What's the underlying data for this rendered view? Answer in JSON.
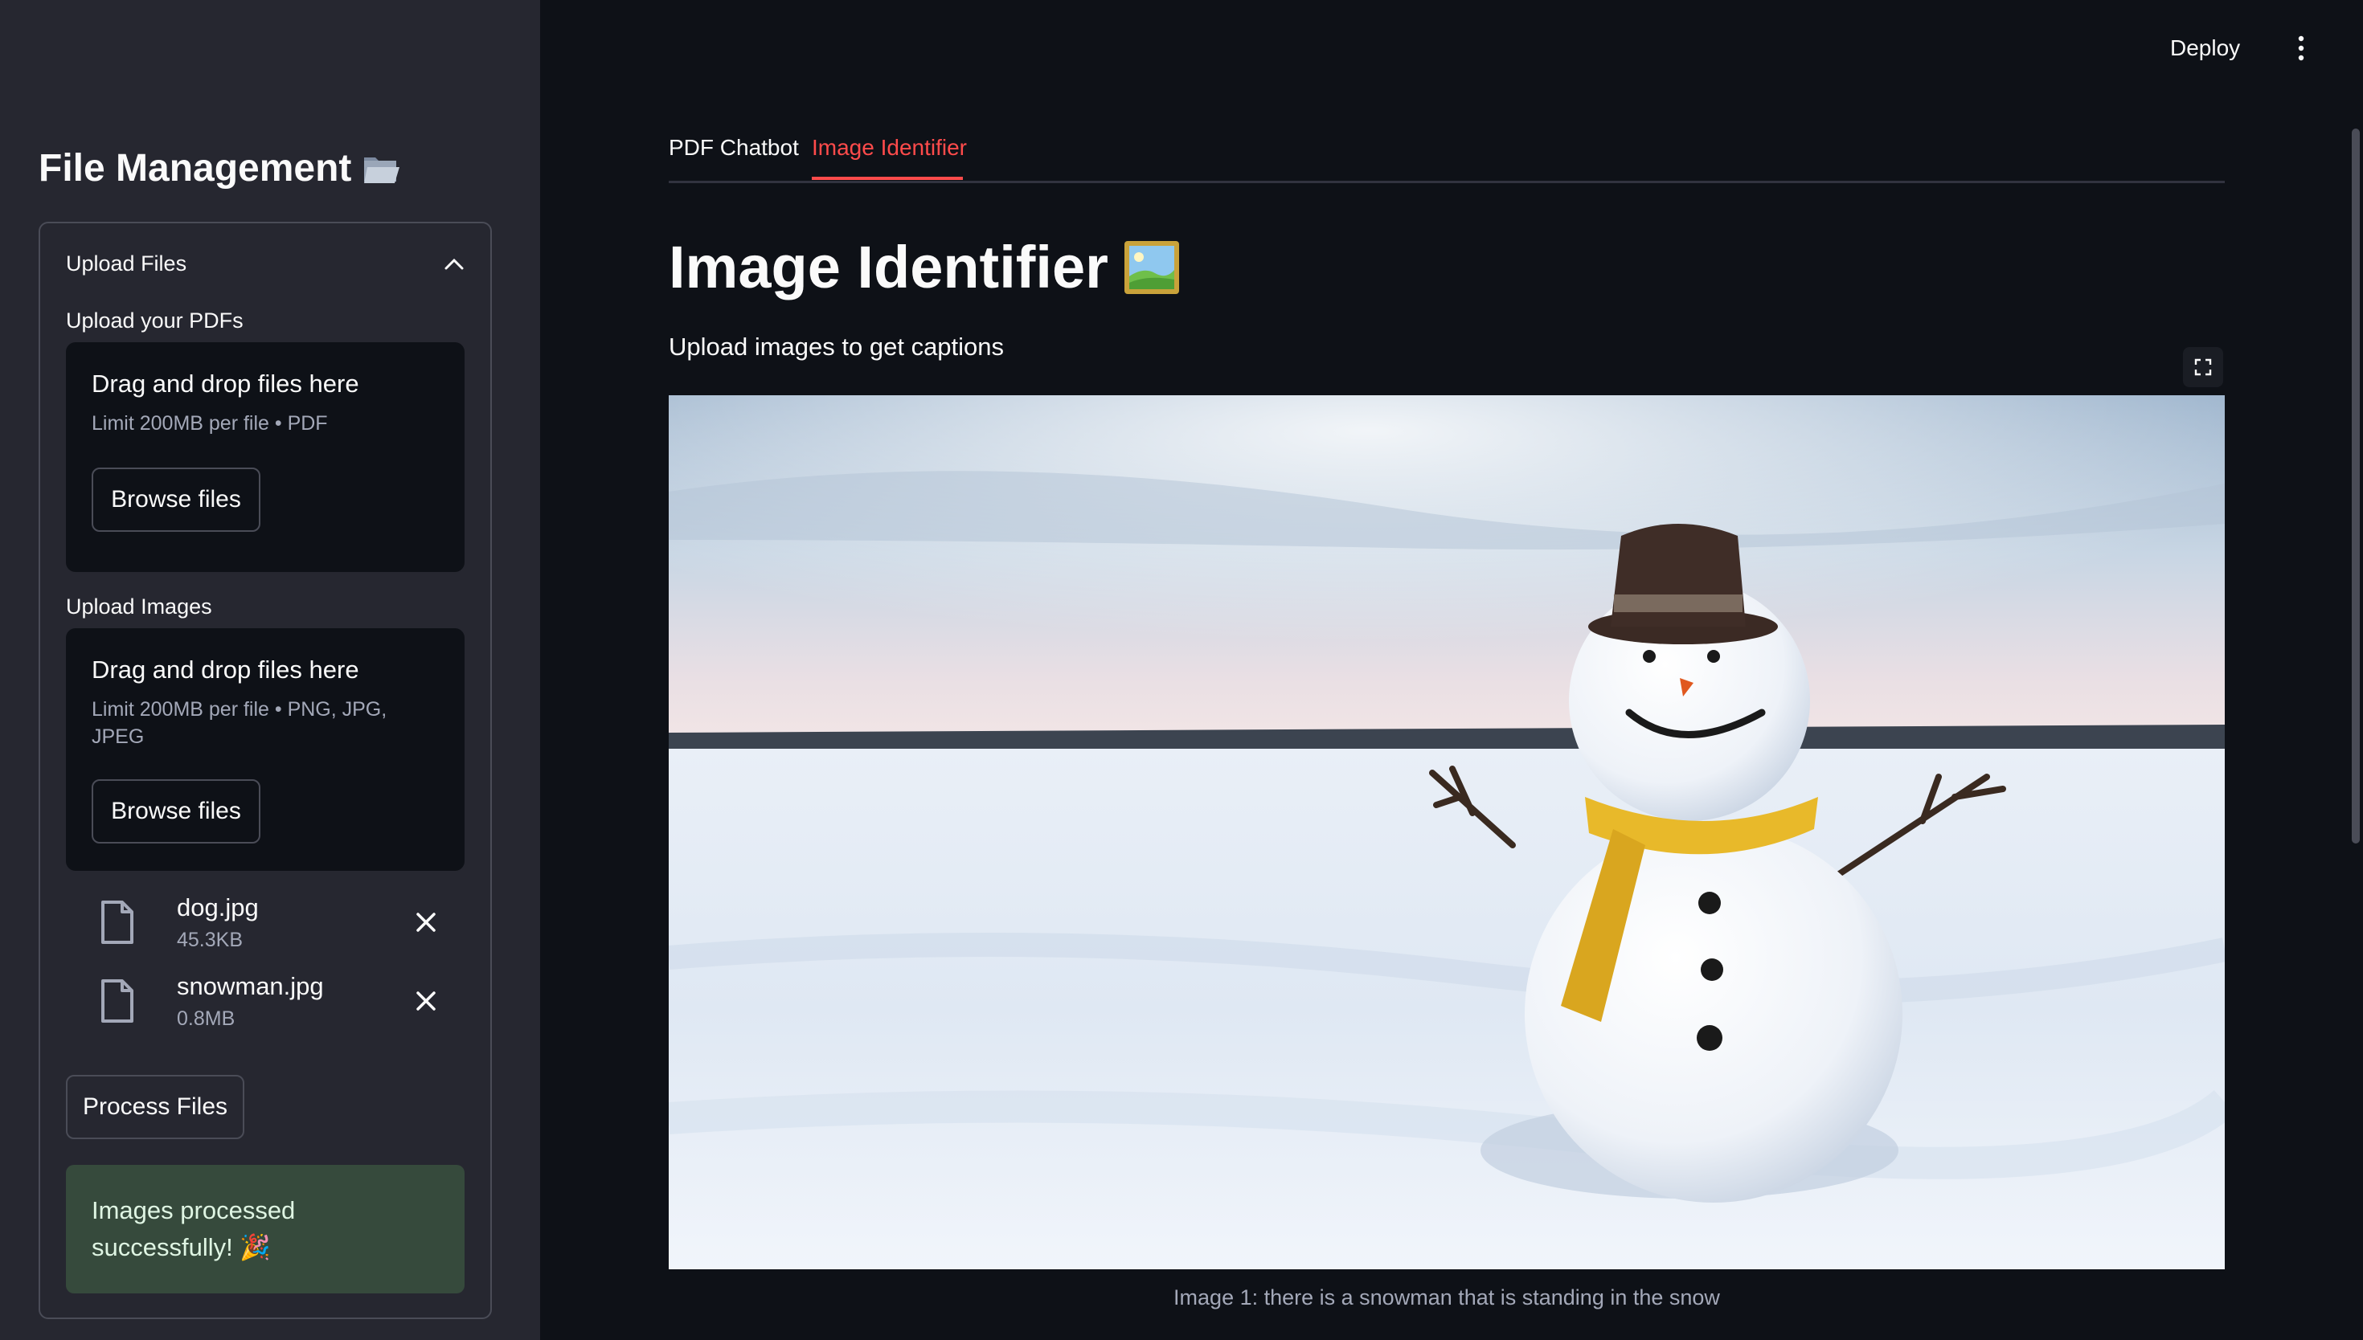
{
  "sidebar": {
    "title": "File Management",
    "expander": {
      "label": "Upload Files",
      "pdf_uploader": {
        "label": "Upload your PDFs",
        "dropzone_title": "Drag and drop files here",
        "limit": "Limit 200MB per file • PDF",
        "browse_label": "Browse files"
      },
      "image_uploader": {
        "label": "Upload Images",
        "dropzone_title": "Drag and drop files here",
        "limit": "Limit 200MB per file • PNG, JPG, JPEG",
        "browse_label": "Browse files"
      },
      "files": [
        {
          "name": "dog.jpg",
          "size": "45.3KB"
        },
        {
          "name": "snowman.jpg",
          "size": "0.8MB"
        }
      ],
      "process_label": "Process Files",
      "success_message": "Images processed successfully! 🎉"
    }
  },
  "header": {
    "deploy_label": "Deploy"
  },
  "tabs": [
    {
      "label": "PDF Chatbot",
      "active": false
    },
    {
      "label": "Image Identifier",
      "active": true
    }
  ],
  "main": {
    "title": "Image Identifier",
    "subtitle": "Upload images to get captions",
    "caption": "Image 1: there is a snowman that is standing in the snow"
  },
  "colors": {
    "accent": "#ff4b4b",
    "sidebar_bg": "#262730",
    "main_bg": "#0e1117",
    "success_bg": "#364a3c"
  }
}
